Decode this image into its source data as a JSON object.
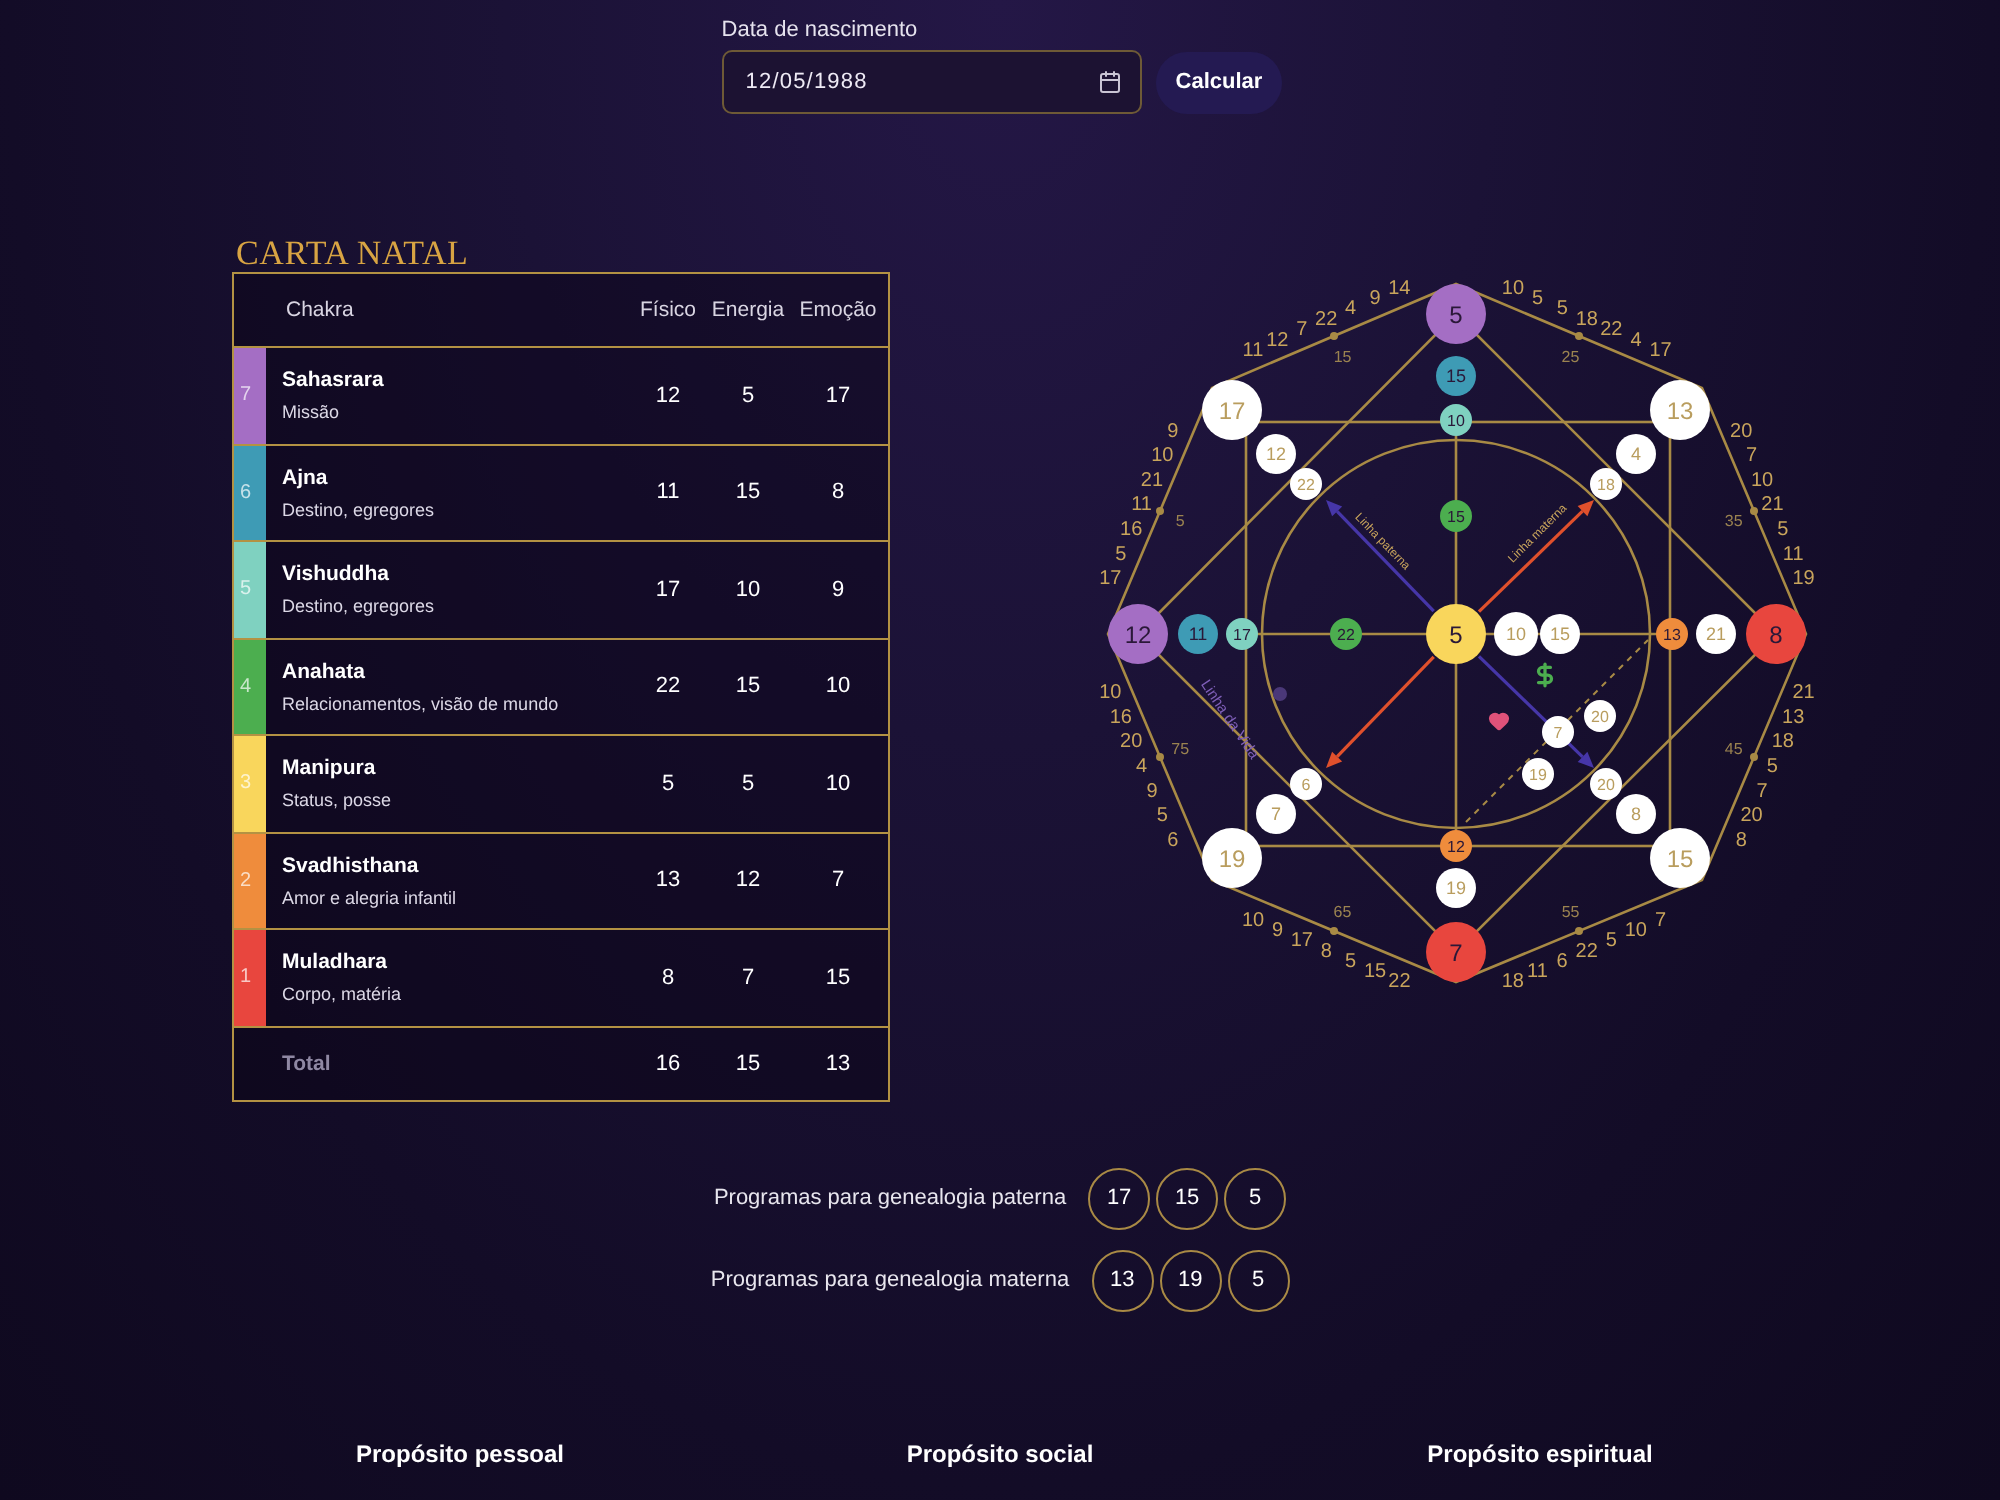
{
  "birth_date": {
    "label": "Data de nascimento",
    "value": "12/05/1988"
  },
  "calculate_button": {
    "label": "Calcular"
  },
  "natal_chart": {
    "title": "CARTA NATAL",
    "columns": [
      "Chakra",
      "Físico",
      "Energia",
      "Emoção"
    ],
    "rows": [
      {
        "number": "7",
        "name": "Sahasrara",
        "description": "Missão",
        "color": "#a46ec4",
        "values": [
          "12",
          "5",
          "17"
        ]
      },
      {
        "number": "6",
        "name": "Ajna",
        "description": "Destino, egregores",
        "color": "#3e9bb5",
        "values": [
          "11",
          "15",
          "8"
        ]
      },
      {
        "number": "5",
        "name": "Vishuddha",
        "description": "Destino, egregores",
        "color": "#7fd1c0",
        "values": [
          "17",
          "10",
          "9"
        ]
      },
      {
        "number": "4",
        "name": "Anahata",
        "description": "Relacionamentos, visão de mundo",
        "color": "#4cae4f",
        "values": [
          "22",
          "15",
          "10"
        ]
      },
      {
        "number": "3",
        "name": "Manipura",
        "description": "Status, posse",
        "color": "#f9d65c",
        "values": [
          "5",
          "5",
          "10"
        ]
      },
      {
        "number": "2",
        "name": "Svadhisthana",
        "description": "Amor e alegria infantil",
        "color": "#ef8c3c",
        "values": [
          "13",
          "12",
          "7"
        ]
      },
      {
        "number": "1",
        "name": "Muladhara",
        "description": "Corpo, matéria",
        "color": "#e8463e",
        "values": [
          "8",
          "7",
          "15"
        ]
      }
    ],
    "total": {
      "label": "Total",
      "values": [
        "16",
        "15",
        "13"
      ]
    }
  },
  "destiny_matrix": {
    "center": {
      "value": "5",
      "color": "#f9d65c"
    },
    "arms": [
      {
        "nodes": [
          {
            "value": "5",
            "color": "#a46ec4"
          },
          {
            "value": "15",
            "color": "#3e9bb5"
          },
          {
            "value": "10",
            "color": "#7fd1c0"
          },
          {
            "value": "15",
            "color": "#4cae4f"
          }
        ]
      },
      {
        "nodes": [
          {
            "value": "12",
            "color": "#a46ec4"
          },
          {
            "value": "11",
            "color": "#3e9bb5"
          },
          {
            "value": "17",
            "color": "#7fd1c0"
          },
          {
            "value": "22",
            "color": "#4cae4f"
          }
        ]
      },
      {
        "nodes": [
          {
            "value": "10",
            "color": "#ffffff"
          },
          {
            "value": "15",
            "color": "#ffffff"
          },
          {
            "value": "13",
            "color": "#ef8c3c"
          },
          {
            "value": "21",
            "color": "#ffffff"
          },
          {
            "value": "8",
            "color": "#e8463e"
          }
        ]
      },
      {
        "nodes": [
          {
            "value": "12",
            "color": "#ef8c3c"
          },
          {
            "value": "19",
            "color": "#ffffff"
          },
          {
            "value": "7",
            "color": "#e8463e"
          }
        ]
      }
    ],
    "corners": [
      {
        "nodes": [
          {
            "value": "17",
            "color": "#ffffff"
          },
          {
            "value": "12",
            "color": "#ffffff"
          },
          {
            "value": "22",
            "color": "#ffffff"
          }
        ]
      },
      {
        "nodes": [
          {
            "value": "13",
            "color": "#ffffff"
          },
          {
            "value": "4",
            "color": "#ffffff"
          },
          {
            "value": "18",
            "color": "#ffffff"
          }
        ]
      },
      {
        "nodes": [
          {
            "value": "6",
            "color": "#ffffff"
          },
          {
            "value": "7",
            "color": "#ffffff"
          },
          {
            "value": "19",
            "color": "#ffffff"
          }
        ]
      },
      {
        "nodes": [
          {
            "value": "20",
            "color": "#ffffff"
          },
          {
            "value": "8",
            "color": "#ffffff"
          },
          {
            "value": "15",
            "color": "#ffffff"
          }
        ]
      }
    ],
    "inner_nodes": [
      {
        "value": "20",
        "color": "#ffffff"
      },
      {
        "value": "7",
        "color": "#ffffff"
      },
      {
        "value": "19",
        "color": "#ffffff"
      }
    ],
    "line_labels": [
      "Linha paterna",
      "Linha materna",
      "Linha da Vida"
    ],
    "outer_edges": [
      {
        "age": "15",
        "numbers": [
          "11",
          "12",
          "7",
          "22",
          "4",
          "9",
          "14"
        ]
      },
      {
        "age": "25",
        "numbers": [
          "10",
          "5",
          "5",
          "18",
          "22",
          "4",
          "17"
        ]
      },
      {
        "age": "5",
        "numbers": [
          "9",
          "10",
          "21",
          "11",
          "16",
          "5",
          "17"
        ]
      },
      {
        "age": "35",
        "numbers": [
          "20",
          "7",
          "10",
          "21",
          "5",
          "11",
          "19"
        ]
      },
      {
        "age": "75",
        "numbers": [
          "10",
          "16",
          "20",
          "4",
          "9",
          "5",
          "6"
        ]
      },
      {
        "age": "45",
        "numbers": [
          "21",
          "13",
          "18",
          "5",
          "7",
          "20",
          "8"
        ]
      },
      {
        "age": "65",
        "numbers": [
          "10",
          "9",
          "17",
          "8",
          "5",
          "15",
          "22"
        ]
      },
      {
        "age": "55",
        "numbers": [
          "18",
          "11",
          "6",
          "22",
          "5",
          "10",
          "7"
        ]
      }
    ]
  },
  "programs": [
    {
      "label": "Programas para genealogia paterna",
      "values": [
        "17",
        "15",
        "5"
      ]
    },
    {
      "label": "Programas para genealogia materna",
      "values": [
        "13",
        "19",
        "5"
      ]
    }
  ],
  "purposes": [
    "Propósito pessoal",
    "Propósito social",
    "Propósito espiritual"
  ]
}
